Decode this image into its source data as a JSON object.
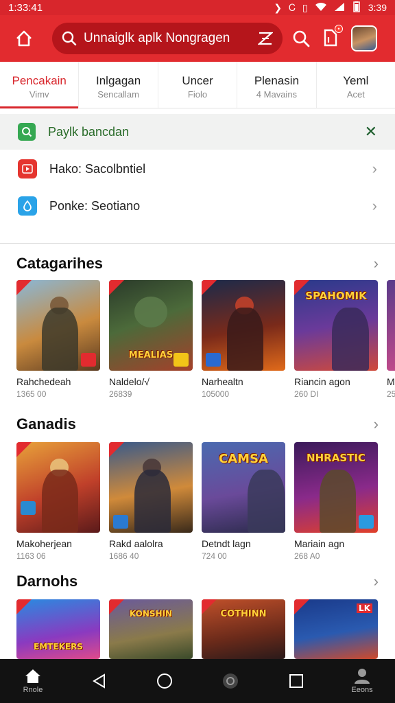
{
  "status": {
    "time_left": "1:33:41",
    "time_right": "3:39"
  },
  "search": {
    "text": "Unnaiglk aplk Nongragen"
  },
  "tabs": [
    {
      "label": "Pencakain",
      "sub": "Vimv"
    },
    {
      "label": "Inlgagan",
      "sub": "Sencallam"
    },
    {
      "label": "Uncer",
      "sub": "Fiolo"
    },
    {
      "label": "Plenasin",
      "sub": "4 Mavains"
    },
    {
      "label": "Yeml",
      "sub": "Acet"
    }
  ],
  "suggestion": {
    "label": "Paylk bancdan"
  },
  "rows": [
    {
      "label": "Hako: Sacolbntiel"
    },
    {
      "label": "Ponke: Seotiano"
    }
  ],
  "sections": [
    {
      "title": "Catagarihes",
      "items": [
        {
          "name": "Rahchedeah",
          "count": "1365 00"
        },
        {
          "name": "Naldelo/√",
          "count": "26839",
          "logo": "MEALIAS"
        },
        {
          "name": "Narhealtn",
          "count": "105000"
        },
        {
          "name": "Riancin agon",
          "count": "260 DI",
          "logo": "SPAHOMIK"
        },
        {
          "name": "M",
          "count": "25"
        }
      ]
    },
    {
      "title": "Ganadis",
      "items": [
        {
          "name": "Makoherjean",
          "count": "1163 06"
        },
        {
          "name": "Rakd aalolra",
          "count": "1686 40"
        },
        {
          "name": "Detndt lagn",
          "count": "724 00",
          "logo": "CAMSA"
        },
        {
          "name": "Mariain agn",
          "count": "268 A0",
          "logo": "NHRASTIC"
        }
      ]
    },
    {
      "title": "Darnohs",
      "items": [
        {
          "name": "",
          "count": "",
          "logo": "EMTEKERS"
        },
        {
          "name": "",
          "count": "",
          "logo": "KONSHIN"
        },
        {
          "name": "",
          "count": "",
          "logo": "COTHINN"
        },
        {
          "name": "",
          "count": "",
          "logo": "LK"
        }
      ]
    }
  ],
  "nav": {
    "home_label": "Rnole",
    "profile_label": "Eeons"
  },
  "colors": {
    "brand": "#e22b2f",
    "brand_dark": "#b5151b",
    "suggest_green": "#35a852"
  }
}
